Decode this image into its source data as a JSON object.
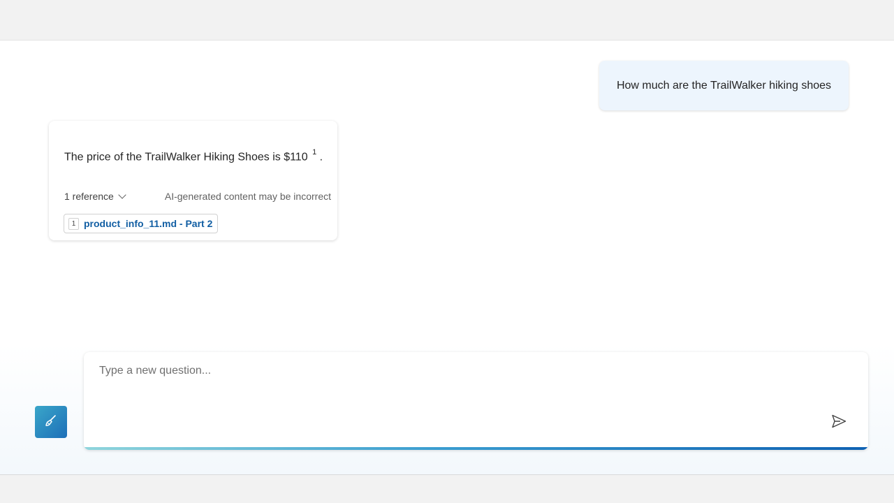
{
  "conversation": {
    "user_question": "How much are the TrailWalker hiking shoes",
    "answer": {
      "text": "The price of the TrailWalker Hiking Shoes is $110",
      "citation_marker": "1",
      "trailing": ".",
      "references_label": "1 reference",
      "disclaimer": "AI-generated content may be incorrect",
      "citations": [
        {
          "number": "1",
          "label": "product_info_11.md - Part 2"
        }
      ]
    }
  },
  "composer": {
    "placeholder": "Type a new question...",
    "value": ""
  },
  "icons": {
    "clear_chat": "broom-icon",
    "send": "send-icon",
    "references_toggle": "chevron-down-icon"
  },
  "colors": {
    "user_bubble": "#edf5fd",
    "citation_link": "#115ea3",
    "accent_start": "#3aa6c9",
    "accent_end": "#1d6fb8"
  }
}
